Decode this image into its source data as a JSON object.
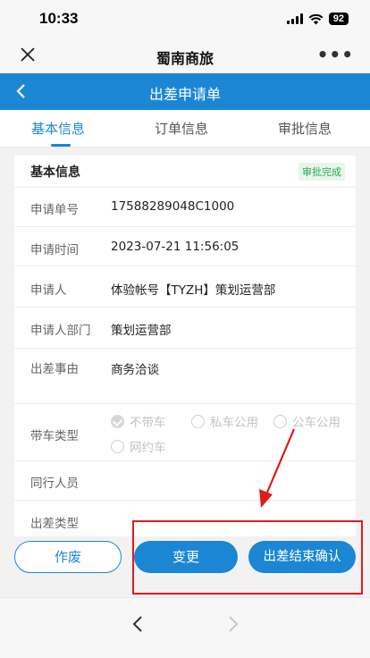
{
  "status_bar": {
    "time": "10:33",
    "battery": "92"
  },
  "app_bar": {
    "title": "蜀南商旅"
  },
  "nav": {
    "title": "出差申请单"
  },
  "tabs": [
    {
      "label": "基本信息",
      "active": true
    },
    {
      "label": "订单信息",
      "active": false
    },
    {
      "label": "审批信息",
      "active": false
    }
  ],
  "card": {
    "title": "基本信息",
    "status_badge": "审批完成",
    "fields": {
      "application_no": {
        "label": "申请单号",
        "value": "17588289048C1000"
      },
      "application_time": {
        "label": "申请时间",
        "value": "2023-07-21 11:56:05"
      },
      "applicant": {
        "label": "申请人",
        "value": "体验帐号【TYZH】策划运营部"
      },
      "department": {
        "label": "申请人部门",
        "value": "策划运营部"
      },
      "reason": {
        "label": "出差事由",
        "value": "商务洽谈"
      },
      "vehicle_type": {
        "label": "带车类型",
        "options": [
          "不带车",
          "私车公用",
          "公车公用",
          "网约车"
        ],
        "selected": "不带车"
      },
      "companions": {
        "label": "同行人员",
        "value": ""
      },
      "trip_type": {
        "label": "出差类型",
        "value": ""
      }
    }
  },
  "actions": {
    "void_label": "作废",
    "change_label": "变更",
    "end_confirm_label": "出差结束确认"
  },
  "colors": {
    "accent": "#1b87d4",
    "highlight": "#e01b1b",
    "badge_text": "#2fa84f"
  }
}
